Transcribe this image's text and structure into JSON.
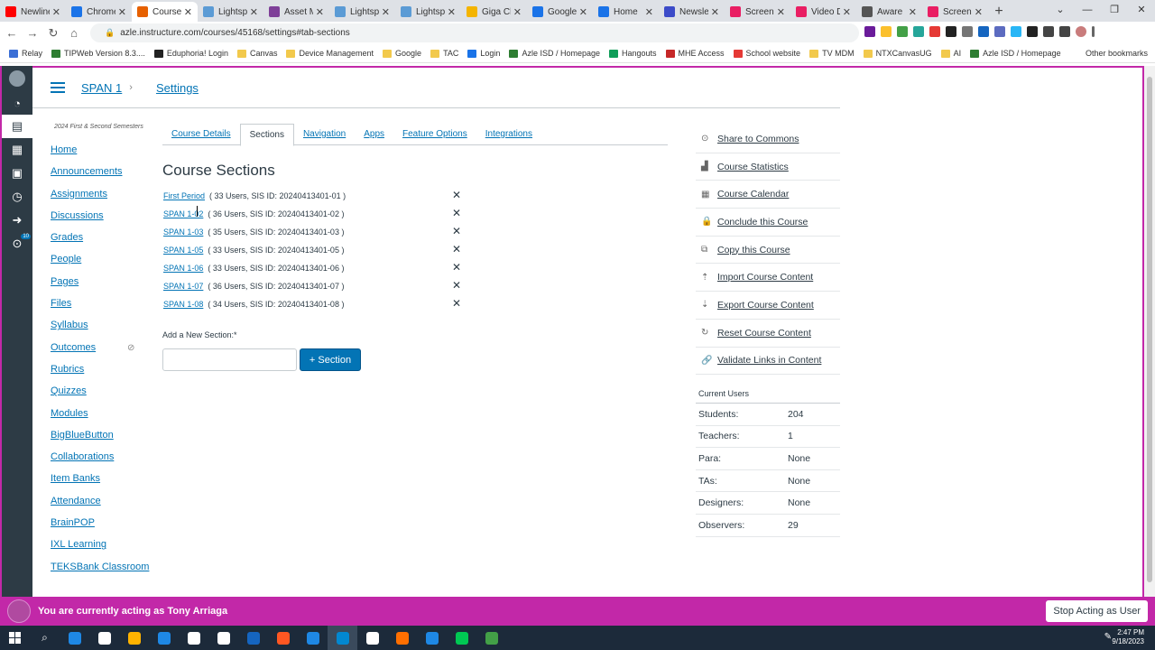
{
  "browser": {
    "tabs": [
      {
        "title": "Newline",
        "color": "#ff0000"
      },
      {
        "title": "Chrome",
        "color": "#1a73e8"
      },
      {
        "title": "Course",
        "color": "#e66000",
        "active": true
      },
      {
        "title": "Lightsp",
        "color": "#5b9bd5"
      },
      {
        "title": "Asset M",
        "color": "#7e3f98"
      },
      {
        "title": "Lightsp",
        "color": "#5b9bd5"
      },
      {
        "title": "Lightsp",
        "color": "#5b9bd5"
      },
      {
        "title": "Giga Ch",
        "color": "#f4b400"
      },
      {
        "title": "Google",
        "color": "#1a73e8"
      },
      {
        "title": "Home",
        "color": "#1a73e8"
      },
      {
        "title": "Newsle",
        "color": "#3c4bc8"
      },
      {
        "title": "Screen",
        "color": "#e91e63"
      },
      {
        "title": "Video D",
        "color": "#e91e63"
      },
      {
        "title": "Aware",
        "color": "#555555"
      },
      {
        "title": "Screen",
        "color": "#e91e63"
      }
    ],
    "url": "azle.instructure.com/courses/45168/settings#tab-sections",
    "bookmarks": [
      {
        "label": "Relay",
        "color": "#3b6fd6"
      },
      {
        "label": "TIPWeb Version 8.3....",
        "color": "#2e7d32"
      },
      {
        "label": "Eduphoria! Login",
        "color": "#222222"
      },
      {
        "label": "Canvas",
        "color": "#f2c94c"
      },
      {
        "label": "Device Management",
        "color": "#f2c94c"
      },
      {
        "label": "Google",
        "color": "#f2c94c"
      },
      {
        "label": "TAC",
        "color": "#f2c94c"
      },
      {
        "label": "Login",
        "color": "#1a73e8"
      },
      {
        "label": "Azle ISD / Homepage",
        "color": "#2e7d32"
      },
      {
        "label": "Hangouts",
        "color": "#0f9d58"
      },
      {
        "label": "MHE Access",
        "color": "#c62828"
      },
      {
        "label": "School website",
        "color": "#e53935"
      },
      {
        "label": "TV MDM",
        "color": "#f2c94c"
      },
      {
        "label": "NTXCanvasUG",
        "color": "#f2c94c"
      },
      {
        "label": "AI",
        "color": "#f2c94c"
      },
      {
        "label": "Azle ISD / Homepage",
        "color": "#2e7d32"
      }
    ],
    "other_bookmarks": "Other bookmarks"
  },
  "header": {
    "course": "SPAN 1",
    "page": "Settings",
    "term": "2024 First & Second Semesters"
  },
  "course_nav": {
    "items": [
      "Home",
      "Announcements",
      "Assignments",
      "Discussions",
      "Grades",
      "People",
      "Pages",
      "Files",
      "Syllabus",
      "Outcomes",
      "Rubrics",
      "Quizzes",
      "Modules",
      "BigBlueButton",
      "Collaborations",
      "Item Banks",
      "Attendance",
      "BrainPOP",
      "IXL Learning"
    ],
    "last_item": "TEKSBank Classroom"
  },
  "settings_tabs": [
    "Course Details",
    "Sections",
    "Navigation",
    "Apps",
    "Feature Options",
    "Integrations"
  ],
  "sections": {
    "title": "Course Sections",
    "rows": [
      {
        "name": "First Period",
        "info": "( 33 Users, SIS ID: 20240413401-01 )"
      },
      {
        "name": "SPAN 1-02",
        "info": "( 36 Users, SIS ID: 20240413401-02 )"
      },
      {
        "name": "SPAN 1-03",
        "info": "( 35 Users, SIS ID: 20240413401-03 )"
      },
      {
        "name": "SPAN 1-05",
        "info": "( 33 Users, SIS ID: 20240413401-05 )"
      },
      {
        "name": "SPAN 1-06",
        "info": "( 33 Users, SIS ID: 20240413401-06 )"
      },
      {
        "name": "SPAN 1-07",
        "info": "( 36 Users, SIS ID: 20240413401-07 )"
      },
      {
        "name": "SPAN 1-08",
        "info": "( 34 Users, SIS ID: 20240413401-08 )"
      }
    ],
    "add_label": "Add a New Section:*",
    "add_button": "+ Section"
  },
  "right_actions": [
    {
      "label": "Share to Commons",
      "icon": "share-icon",
      "glyph": "⊙"
    },
    {
      "label": "Course Statistics",
      "icon": "bar-chart-icon",
      "glyph": "▟"
    },
    {
      "label": "Course Calendar",
      "icon": "calendar-icon",
      "glyph": "▦"
    },
    {
      "label": "Conclude this Course",
      "icon": "lock-icon",
      "glyph": "🔒"
    },
    {
      "label": "Copy this Course",
      "icon": "copy-icon",
      "glyph": "⧉"
    },
    {
      "label": "Import Course Content",
      "icon": "upload-icon",
      "glyph": "⇡"
    },
    {
      "label": "Export Course Content",
      "icon": "download-icon",
      "glyph": "⇣"
    },
    {
      "label": "Reset Course Content",
      "icon": "reset-icon",
      "glyph": "↻"
    },
    {
      "label": "Validate Links in Content",
      "icon": "link-icon",
      "glyph": "🔗"
    }
  ],
  "current_users": {
    "title": "Current Users",
    "rows": [
      {
        "k": "Students:",
        "v": "204"
      },
      {
        "k": "Teachers:",
        "v": "1"
      },
      {
        "k": "Para:",
        "v": "None"
      },
      {
        "k": "TAs:",
        "v": "None"
      },
      {
        "k": "Designers:",
        "v": "None"
      },
      {
        "k": "Observers:",
        "v": "29"
      }
    ]
  },
  "masquerade": {
    "message": "You are currently acting as Tony Arriaga",
    "stop": "Stop Acting as User"
  },
  "global_nav": {
    "badge": "10"
  },
  "taskbar": {
    "apps": [
      "#1e88e5",
      "#ffffff",
      "#ffb300",
      "#1e88e5",
      "#ffffff",
      "#ffffff",
      "#1565c0",
      "#ff5722",
      "#1e88e5",
      "#0288d1",
      "#ffffff",
      "#ff6f00",
      "#1e88e5",
      "#00c853",
      "#43a047"
    ],
    "time": "2:47 PM",
    "date": "9/18/2023"
  },
  "colors": {
    "accent": "#0374b5",
    "masquerade": "#c228a8",
    "nav_bg": "#2d3b45"
  }
}
